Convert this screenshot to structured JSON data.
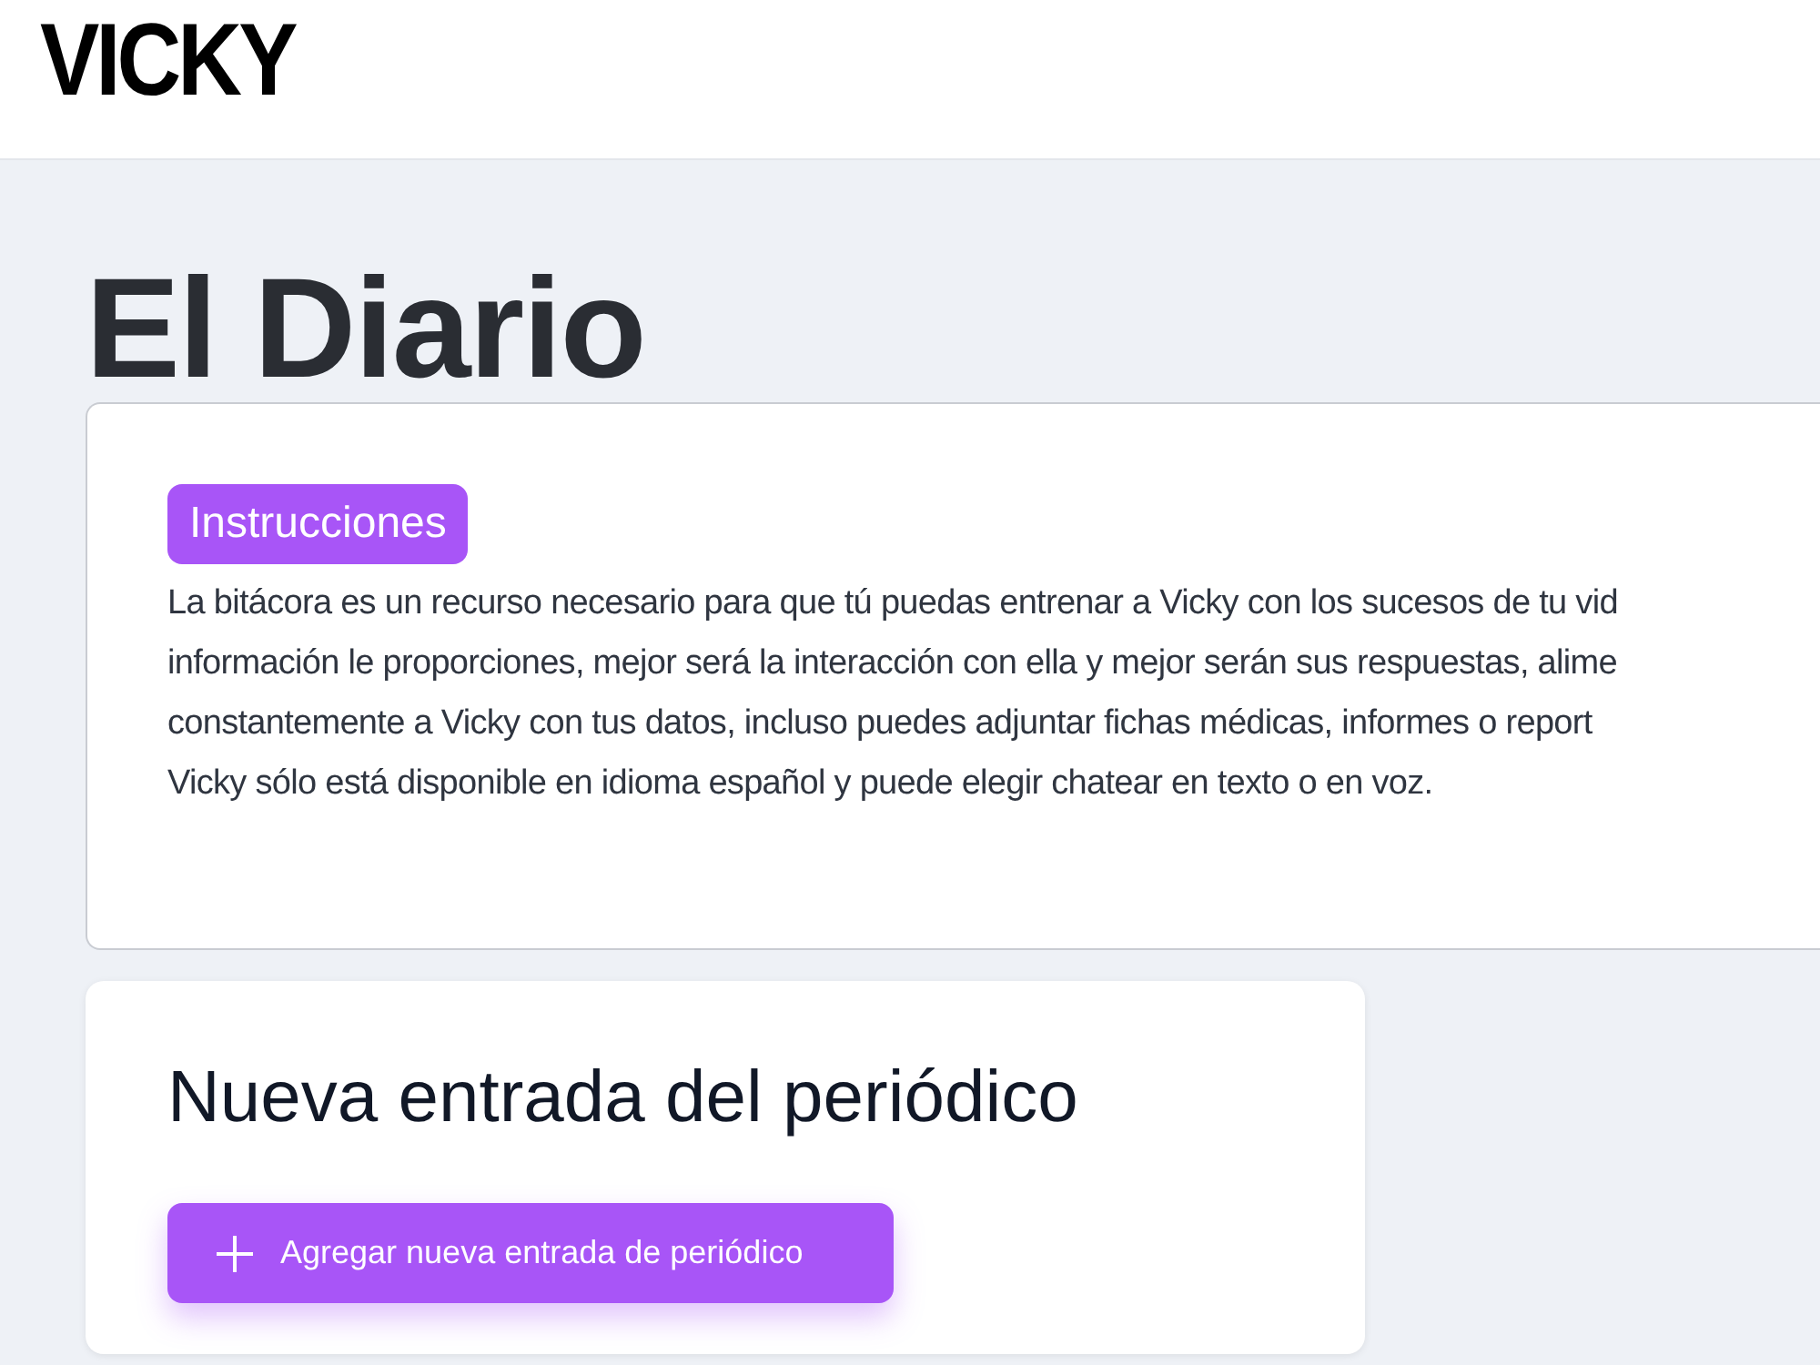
{
  "header": {
    "logo": "VICKY"
  },
  "page_title": "El Diario",
  "instructions": {
    "badge": "Instrucciones",
    "lines": [
      "La bitácora es un recurso necesario para que tú puedas entrenar a Vicky con los sucesos de tu vid",
      "información le proporciones, mejor será la interacción con ella y mejor serán sus respuestas, alime",
      "constantemente a Vicky con tus datos, incluso puedes adjuntar fichas médicas, informes o report",
      "Vicky sólo está disponible en idioma español y puede elegir chatear en texto o en voz."
    ]
  },
  "new_entry": {
    "title": "Nueva entrada del periódico",
    "button": "Agregar nueva entrada de periódico"
  }
}
